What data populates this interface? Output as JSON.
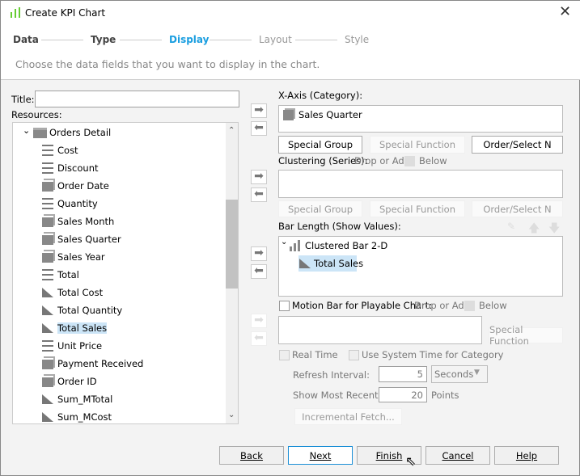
{
  "window": {
    "title": "Create KPI Chart"
  },
  "steps": [
    "Data",
    "Type",
    "Display",
    "Layout",
    "Style"
  ],
  "active_step": "Display",
  "description": "Choose the data fields that you want to display in the chart.",
  "left": {
    "title_label": "Title:",
    "title_value": "",
    "resources_label": "Resources:",
    "group": "Orders Detail",
    "items": [
      {
        "label": "Cost",
        "icon": "dimension-lines-icon"
      },
      {
        "label": "Discount",
        "icon": "dimension-lines-icon"
      },
      {
        "label": "Order Date",
        "icon": "group-field-icon"
      },
      {
        "label": "Quantity",
        "icon": "dimension-lines-icon"
      },
      {
        "label": "Sales Month",
        "icon": "group-field-icon"
      },
      {
        "label": "Sales Quarter",
        "icon": "group-field-icon"
      },
      {
        "label": "Sales Year",
        "icon": "group-field-icon"
      },
      {
        "label": "Total",
        "icon": "dimension-lines-icon"
      },
      {
        "label": "Total Cost",
        "icon": "measure-icon"
      },
      {
        "label": "Total Quantity",
        "icon": "measure-icon"
      },
      {
        "label": "Total Sales",
        "icon": "measure-icon",
        "selected": true
      },
      {
        "label": "Unit Price",
        "icon": "dimension-lines-icon"
      },
      {
        "label": "Payment Received",
        "icon": "group-field-icon"
      },
      {
        "label": "Order ID",
        "icon": "group-field-icon"
      },
      {
        "label": "Sum_MTotal",
        "icon": "measure-icon"
      },
      {
        "label": "Sum_MCost",
        "icon": "measure-icon"
      }
    ]
  },
  "xaxis": {
    "label": "X-Axis (Category):",
    "field": "Sales Quarter",
    "buttons": [
      "Special Group",
      "Special Function",
      "Order/Select N"
    ]
  },
  "clustering": {
    "label": "Clustering (Series):",
    "hint1": "Drop or Add",
    "hint2": "Below",
    "buttons": [
      "Special Group",
      "Special Function",
      "Order/Select N"
    ]
  },
  "bar": {
    "label": "Bar Length (Show Values):",
    "chart": "Clustered Bar 2-D",
    "field": "Total Sales"
  },
  "motion": {
    "label": "Motion Bar for Playable Chart:",
    "hint1": "Drop or Add",
    "hint2": "Below",
    "special": "Special Function"
  },
  "realtime": {
    "real_time": "Real Time",
    "system_time": "Use System Time for Category",
    "refresh_label": "Refresh Interval:",
    "refresh_value": "5",
    "refresh_unit": "Seconds",
    "recent_label": "Show Most Recent:",
    "recent_value": "20",
    "recent_unit": "Points",
    "fetch": "Incremental Fetch..."
  },
  "footer": {
    "back": "Back",
    "next": "Next",
    "finish": "Finish",
    "cancel": "Cancel",
    "help": "Help"
  }
}
